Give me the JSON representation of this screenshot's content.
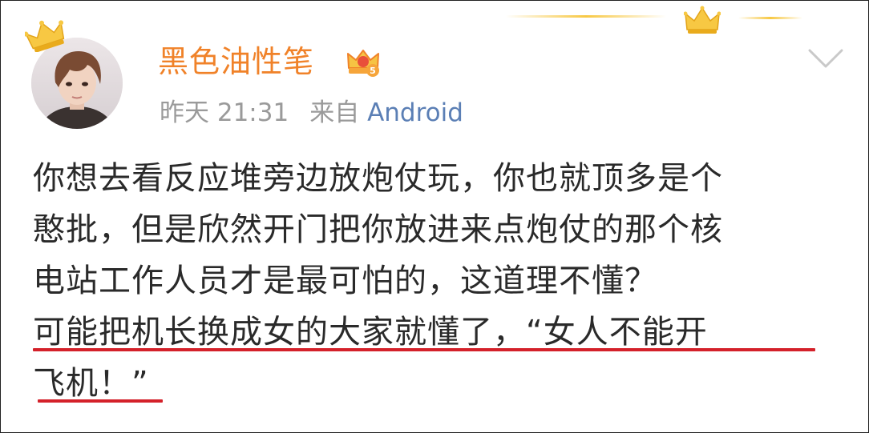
{
  "post": {
    "author": {
      "name": "黑色油性笔",
      "vip_level": "5"
    },
    "meta": {
      "time": "昨天 21:31",
      "source_prefix": "来自",
      "source": "Android"
    },
    "lines": [
      "你想去看反应堆旁边放炮仗玩，你也就顶多是个",
      "憨批，但是欣然开门把你放进来点炮仗的那个核",
      "电站工作人员才是最可怕的，这道理不懂？",
      "可能把机长换成女的大家就懂了，“女人不能开",
      "飞机！”"
    ]
  },
  "colors": {
    "username": "#f08229",
    "meta": "#9a9a9a",
    "source_link": "#5b7fb5",
    "body_text": "#2a2a2a",
    "underline": "#d4212a",
    "crown_gold": "#f7c843"
  },
  "icons": {
    "avatar_crown": "crown-icon",
    "vip_badge": "vip-crown-badge-icon",
    "expand": "chevron-down-icon"
  }
}
